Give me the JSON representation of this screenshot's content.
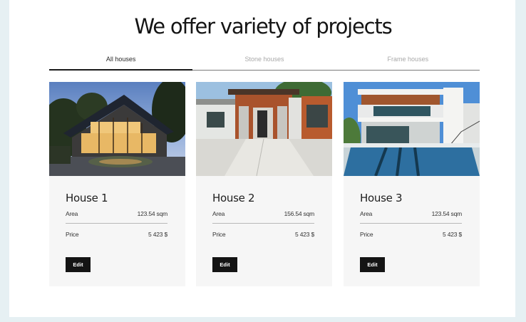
{
  "section": {
    "title": "We offer variety of projects"
  },
  "tabs": [
    {
      "label": "All houses",
      "active": true
    },
    {
      "label": "Stone houses",
      "active": false
    },
    {
      "label": "Frame houses",
      "active": false
    }
  ],
  "cards": [
    {
      "title": "House 1",
      "area_label": "Area",
      "area_value": "123.54 sqm",
      "price_label": "Price",
      "price_value": "5 423 $",
      "button": "Edit"
    },
    {
      "title": "House 2",
      "area_label": "Area",
      "area_value": "156.54 sqm",
      "price_label": "Price",
      "price_value": "5 423 $",
      "button": "Edit"
    },
    {
      "title": "House 3",
      "area_label": "Area",
      "area_value": "123.54 sqm",
      "price_label": "Price",
      "price_value": "5 423 $",
      "button": "Edit"
    }
  ]
}
